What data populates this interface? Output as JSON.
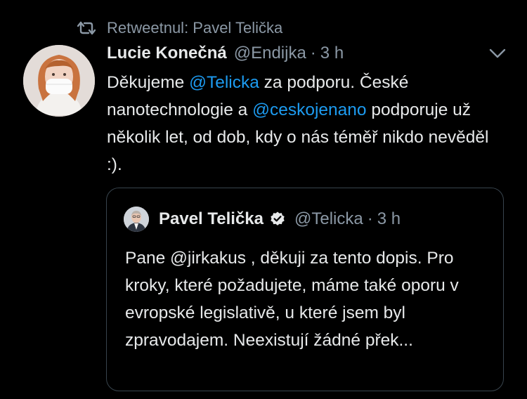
{
  "retweet": {
    "icon": "retweet-icon",
    "text": "Retweetnul: Pavel Telička"
  },
  "tweet": {
    "author_name": "Lucie Konečná",
    "handle": "@Endijka",
    "separator": "·",
    "time": "3 h",
    "text": {
      "part1": "Děkujeme ",
      "mention1": "@Telicka",
      "part2": " za podporu. České nanotechnologie a  ",
      "mention2": "@ceskojenano",
      "part3": " podporuje už několik let, od dob, kdy o nás téměř nikdo nevěděl :)."
    }
  },
  "quoted_tweet": {
    "author_name": "Pavel Telička",
    "handle": "@Telicka",
    "separator": "·",
    "time": "3 h",
    "text": "Pane @jirkakus , děkuji za tento dopis. Pro kroky, které požadujete, máme také oporu v evropské legislativě, u které jsem byl zpravodajem. Neexistují žádné přek..."
  },
  "colors": {
    "background": "#000000",
    "primary_text": "#e7e9ea",
    "secondary_text": "#8b98a5",
    "link": "#1d9bf0",
    "border": "#38444d"
  }
}
